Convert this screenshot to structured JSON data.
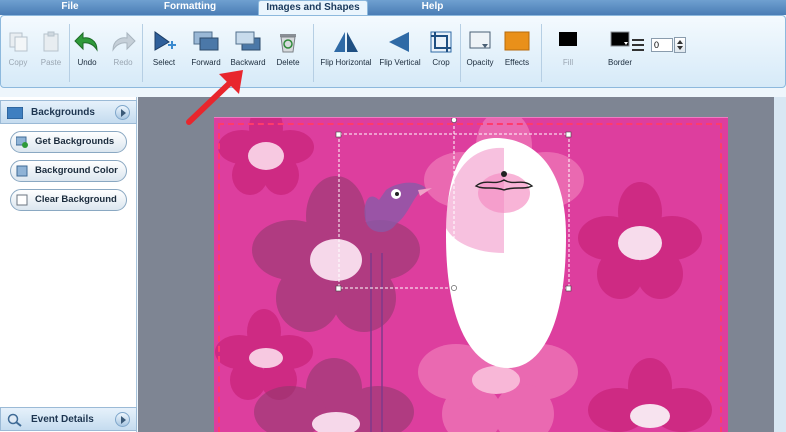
{
  "menu": {
    "tabs": [
      {
        "label": "File",
        "active": false
      },
      {
        "label": "Formatting",
        "active": false
      },
      {
        "label": "Images and Shapes",
        "active": true
      },
      {
        "label": "Help",
        "active": false
      }
    ]
  },
  "toolbar": {
    "copy": "Copy",
    "paste": "Paste",
    "undo": "Undo",
    "redo": "Redo",
    "select": "Select",
    "forward": "Forward",
    "backward": "Backward",
    "delete": "Delete",
    "flip_horizontal": "Flip Horizontal",
    "flip_vertical": "Flip Vertical",
    "crop": "Crop",
    "opacity": "Opacity",
    "effects": "Effects",
    "fill": "Fill",
    "border": "Border",
    "border_width_value": "0"
  },
  "left_panel": {
    "backgrounds_title": "Backgrounds",
    "get_backgrounds": "Get Backgrounds",
    "background_color": "Background Color",
    "clear_background": "Clear Background",
    "event_details_title": "Event Details"
  },
  "colors": {
    "canvas_background": "#dd3e9e",
    "accent_arrow": "#e8262d",
    "effects_orange": "#e9901a"
  }
}
